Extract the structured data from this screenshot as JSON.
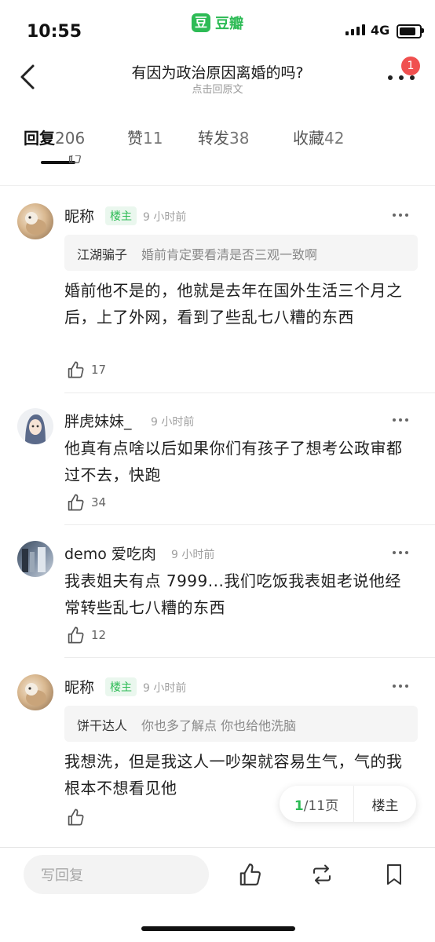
{
  "status": {
    "time": "10:55",
    "network": "4G",
    "app_name": "豆瓣",
    "app_logo": "豆"
  },
  "header": {
    "title": "有因为政治原因离婚的吗?",
    "subtitle": "点击回原文",
    "notification_count": "1"
  },
  "tabs": [
    {
      "label": "回复",
      "count": "206",
      "active": true
    },
    {
      "label": "赞",
      "count": "11"
    },
    {
      "label": "转发",
      "count": "38"
    },
    {
      "label": "收藏",
      "count": "42"
    }
  ],
  "comments": [
    {
      "username": "昵称",
      "badge": "楼主",
      "time": "9 小时前",
      "quote": {
        "name": "江湖骗子",
        "text": "婚前肯定要看清是否三观一致啊"
      },
      "text": "婚前他不是的，他就是去年在国外生活三个月之后，上了外网，看到了些乱七八糟的东西",
      "likes": "17"
    },
    {
      "username": "胖虎妹妹_",
      "time": "9 小时前",
      "text": "他真有点啥以后如果你们有孩子了想考公政审都过不去，快跑",
      "likes": "34"
    },
    {
      "username": "demo 爱吃肉",
      "time": "9 小时前",
      "text": "我表姐夫有点 7999...我们吃饭我表姐老说他经常转些乱七八糟的东西",
      "likes": "12"
    },
    {
      "username": "昵称",
      "badge": "楼主",
      "time": "9 小时前",
      "quote": {
        "name": "饼干达人",
        "text": "你也多了解点 你也给他洗脑"
      },
      "text": "我想洗，但是我这人一吵架就容易生气，气的我根本不想看见他",
      "likes": ""
    }
  ],
  "pager": {
    "current": "1",
    "total_label": "/11页",
    "op_label": "楼主"
  },
  "bottom": {
    "reply_placeholder": "写回复"
  },
  "colors": {
    "accent": "#2dbb55",
    "badge_red": "#f0504f"
  },
  "icons": [
    "back-icon",
    "more-icon",
    "thumbs-up-icon",
    "repost-icon",
    "bookmark-icon"
  ]
}
